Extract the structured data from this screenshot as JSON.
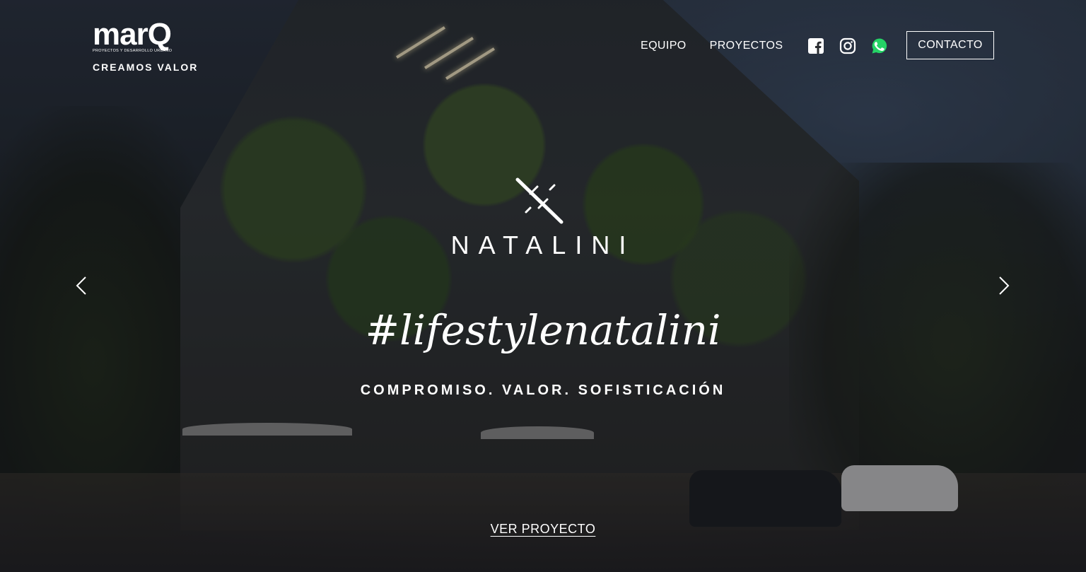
{
  "brand": {
    "logo_text": "marQ",
    "logo_subtitle": "PROYECTOS Y DESARROLLO URBANO",
    "tagline": "CREAMOS VALOR"
  },
  "nav": {
    "items": [
      {
        "label": "EQUIPO"
      },
      {
        "label": "PROYECTOS"
      }
    ],
    "social_icons": [
      "facebook-icon",
      "instagram-icon",
      "whatsapp-icon"
    ],
    "contact_label": "CONTACTO"
  },
  "hero": {
    "project_name": "NATALINI",
    "hashtag": "#lifestylenatalini",
    "tagline": "COMPROMISO. VALOR. SOFISTICACIÓN",
    "cta_label": "VER PROYECTO"
  },
  "carousel": {
    "prev_icon": "chevron-left-icon",
    "next_icon": "chevron-right-icon"
  },
  "colors": {
    "text": "#ffffff",
    "whatsapp": "#25d366",
    "overlay": "#0a0a0c"
  }
}
